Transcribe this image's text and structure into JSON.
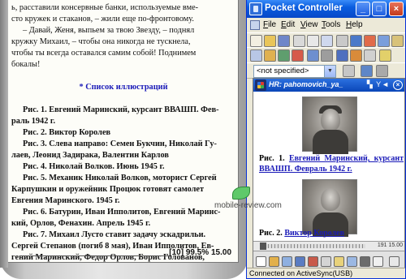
{
  "reader": {
    "lines": [
      "ь, расставили консервные банки, используемые вме-",
      "сто кружек и стаканов, – жили еще по-фронтовому.",
      "– Давай, Женя, выпьем за твою Звезду, – поднял",
      "кружку Михаил, – чтобы она никогда не тускнела,",
      "чтобы ты всегда оставался самим собой! Поднимем",
      "бокалы!"
    ],
    "heading": "* Список иллюстраций",
    "illustrations": [
      [
        "Рис. 1. Евгений Маринский, курсант ВВАШП. Фев-",
        "раль 1942 г."
      ],
      [
        "Рис. 2. Виктор Королев"
      ],
      [
        "Рис. 3. Слева направо: Семен Букчин, Николай Гу-",
        "лаев, Леонид Задирака, Валентин Карлов"
      ],
      [
        "Рис. 4. Николай Волков. Июнь 1945 г."
      ],
      [
        "Рис. 5. Механик Николай Волков, моторист Сергей",
        "Карпушкин и оружейник Процюк готовят самолет",
        "Евгения Маринского. 1945 г."
      ],
      [
        "Рис. 6. Батурин, Иван Ипполитов, Евгений Маринс-",
        "кий, Орлов, Фенахин. Апрель 1945 г."
      ],
      [
        "Рис. 7. Михаил Лусто ставит задачу эскадрильи.",
        "Сергей Степанов (погиб 8 мая), Иван Ипполитов, Ев-",
        "гений Маринский, Федор Орлов, Борис Голованов,"
      ]
    ],
    "status": "[10] 99.5% 15.00"
  },
  "watermark": {
    "text": "mobile-review.com"
  },
  "window": {
    "title": "Pocket Controller",
    "menu": [
      "File",
      "Edit",
      "View",
      "Tools",
      "Help"
    ],
    "combo_value": "<not specified>",
    "status": "Connected on ActiveSync(USB)"
  },
  "pda": {
    "title": "HR: pahomovich_ya_",
    "caption1_prefix": "Рис. 1.",
    "caption1_link": "Евгений Маринский, курсант ВВАШП. Февраль 1942 г.",
    "caption2_prefix": "Рис. 2.",
    "caption2_link": "Виктор Королев",
    "scroll_label": "191 15.00"
  },
  "colors": {
    "titlebar": "#0a5ddf",
    "link": "#1a1ab8",
    "heading": "#1a1ab8"
  }
}
